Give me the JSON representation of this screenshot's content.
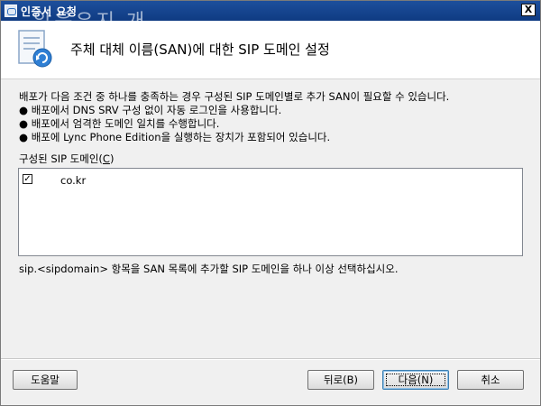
{
  "window": {
    "title": "인증서 요청",
    "watermark": "알음우지 개",
    "close_label": "X"
  },
  "header": {
    "title": "주체 대체 이름(SAN)에 대한 SIP 도메인 설정"
  },
  "body": {
    "intro": "배포가 다음 조건 중 하나를 충족하는 경우 구성된 SIP 도메인별로 추가 SAN이 필요할 수 있습니다.",
    "bullets": [
      "● 배포에서 DNS SRV 구성 없이 자동 로그인을 사용합니다.",
      "● 배포에서 엄격한 도메인 일치를 수행합니다.",
      "● 배포에 Lync Phone Edition을 실행하는 장치가 포함되어 있습니다."
    ],
    "list_label": "구성된 SIP 도메인(",
    "list_label_key": "C",
    "list_label_end": ")",
    "domains": [
      {
        "text": "co.kr",
        "checked": true
      }
    ],
    "hint": "sip.<sipdomain> 항목을 SAN 목록에 추가할 SIP 도메인을 하나 이상 선택하십시오."
  },
  "buttons": {
    "help": "도움말",
    "back": "뒤로(B)",
    "next": "다음(N)",
    "cancel": "취소"
  },
  "icons": {
    "check": "checkbox-checked-icon",
    "header": "certificate-refresh-icon"
  }
}
